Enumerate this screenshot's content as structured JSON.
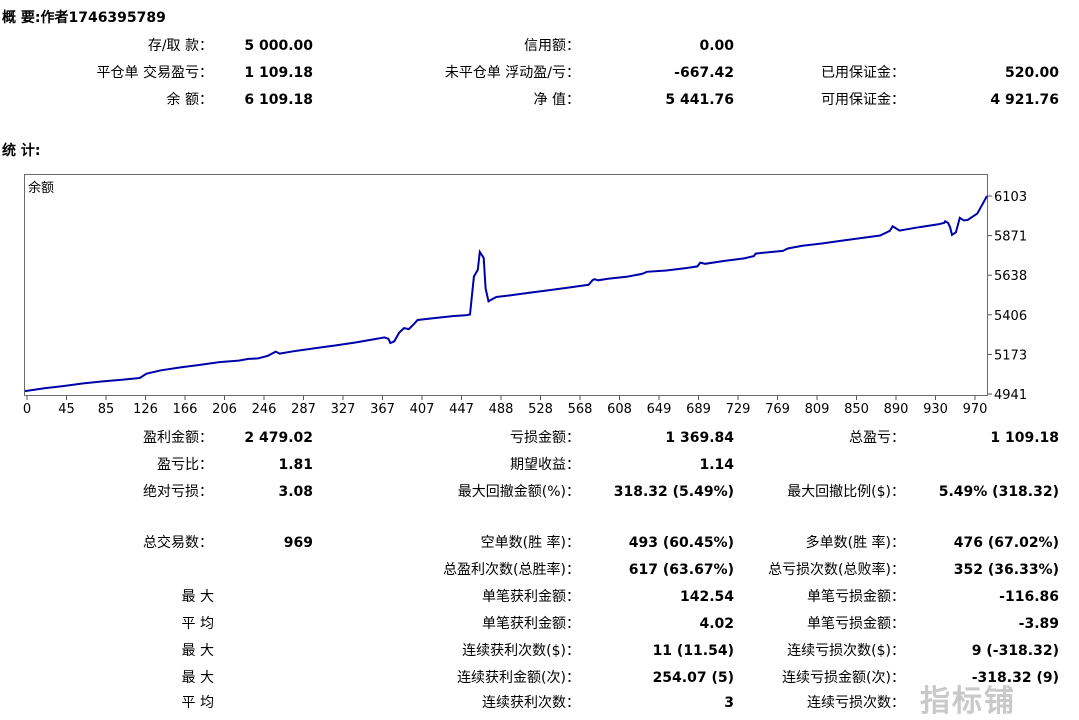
{
  "summary": {
    "title": "概 要:作者1746395789",
    "rows": [
      [
        {
          "label": "存/取 款：",
          "value": "5 000.00"
        },
        {
          "label": "信用额：",
          "value": "0.00"
        },
        {
          "label": "",
          "value": ""
        }
      ],
      [
        {
          "label": "平仓单 交易盈亏：",
          "value": "1 109.18"
        },
        {
          "label": "未平仓单 浮动盈/亏：",
          "value": "-667.42"
        },
        {
          "label": "已用保证金：",
          "value": "520.00"
        }
      ],
      [
        {
          "label": "余 额：",
          "value": "6 109.18"
        },
        {
          "label": "净 值：",
          "value": "5 441.76"
        },
        {
          "label": "可用保证金：",
          "value": "4 921.76"
        }
      ]
    ]
  },
  "stats": {
    "title": "统 计:",
    "rows": [
      {
        "c1": {
          "label": "盈利金额：",
          "value": "2 479.02"
        },
        "c2": {
          "label": "亏损金额：",
          "value": "1 369.84"
        },
        "c3": {
          "label": "总盈亏：",
          "value": "1 109.18"
        }
      },
      {
        "c1": {
          "label": "盈亏比：",
          "value": "1.81"
        },
        "c2": {
          "label": "期望收益：",
          "value": "1.14"
        },
        "c3": {
          "label": "",
          "value": ""
        }
      },
      {
        "c1": {
          "label": "绝对亏损：",
          "value": "3.08"
        },
        "c2": {
          "label": "最大回撤金额(%)：",
          "value": "318.32 (5.49%)"
        },
        "c3": {
          "label": "最大回撤比例($)：",
          "value": "5.49% (318.32)"
        }
      },
      {
        "c1": {
          "label": "总交易数：",
          "value": "969"
        },
        "c2": {
          "label": "空单数(胜 率)：",
          "value": "493 (60.45%)"
        },
        "c3": {
          "label": "多单数(胜 率)：",
          "value": "476 (67.02%)"
        }
      },
      {
        "c1": {
          "label": "",
          "value": ""
        },
        "c2": {
          "label": "总盈利次数(总胜率)：",
          "value": "617 (63.67%)"
        },
        "c3": {
          "label": "总亏损次数(总败率)：",
          "value": "352 (36.33%)"
        }
      },
      {
        "c1": {
          "label": "最 大",
          "value": ""
        },
        "c2": {
          "label": "单笔获利金额：",
          "value": "142.54"
        },
        "c3": {
          "label": "单笔亏损金额：",
          "value": "-116.86"
        }
      },
      {
        "c1": {
          "label": "平 均",
          "value": ""
        },
        "c2": {
          "label": "单笔获利金额：",
          "value": "4.02"
        },
        "c3": {
          "label": "单笔亏损金额：",
          "value": "-3.89"
        }
      },
      {
        "c1": {
          "label": "最 大",
          "value": ""
        },
        "c2": {
          "label": "连续获利次数($)：",
          "value": "11 (11.54)"
        },
        "c3": {
          "label": "连续亏损次数($)：",
          "value": "9 (-318.32)"
        }
      },
      {
        "c1": {
          "label": "最 大",
          "value": ""
        },
        "c2": {
          "label": "连续获利金额(次)：",
          "value": "254.07 (5)"
        },
        "c3": {
          "label": "连续亏损金额(次)：",
          "value": "-318.32 (9)"
        }
      },
      {
        "c1": {
          "label": "平 均",
          "value": ""
        },
        "c2": {
          "label": "连续获利次数：",
          "value": "3"
        },
        "c3": {
          "label": "连续亏损次数：",
          "value": ""
        }
      }
    ]
  },
  "chart_data": {
    "type": "line",
    "title": "余额",
    "x_ticks": [
      "0",
      "45",
      "85",
      "126",
      "166",
      "206",
      "246",
      "287",
      "327",
      "367",
      "407",
      "447",
      "488",
      "528",
      "568",
      "608",
      "649",
      "689",
      "729",
      "769",
      "809",
      "850",
      "890",
      "930",
      "970"
    ],
    "y_ticks": [
      "6103",
      "5871",
      "5638",
      "5406",
      "5173",
      "4941"
    ],
    "xlim": [
      0,
      990
    ],
    "ylim": [
      4941,
      6103
    ],
    "line_color": "#0000aa",
    "series": [
      {
        "x": [
          0,
          20,
          40,
          60,
          80,
          100,
          118,
          125,
          140,
          160,
          180,
          200,
          220,
          230,
          240,
          250,
          258,
          262,
          280,
          300,
          320,
          340,
          360,
          370,
          374,
          376,
          380,
          385,
          390,
          395,
          400,
          404,
          420,
          440,
          455,
          458,
          462,
          466,
          468,
          472,
          474,
          477,
          480,
          485,
          500,
          520,
          540,
          560,
          580,
          584,
          586,
          590,
          600,
          620,
          635,
          640,
          660,
          680,
          692,
          695,
          700,
          720,
          740,
          750,
          752,
          760,
          780,
          785,
          800,
          820,
          840,
          860,
          880,
          890,
          893,
          900,
          920,
          940,
          946,
          947,
          950,
          952,
          954,
          958,
          962,
          966,
          970,
          980,
          990
        ],
        "y": [
          4958,
          4975,
          4988,
          5003,
          5015,
          5025,
          5035,
          5060,
          5080,
          5097,
          5112,
          5128,
          5137,
          5147,
          5150,
          5165,
          5190,
          5178,
          5195,
          5211,
          5226,
          5243,
          5263,
          5273,
          5265,
          5240,
          5250,
          5300,
          5328,
          5322,
          5350,
          5375,
          5385,
          5398,
          5404,
          5408,
          5630,
          5670,
          5775,
          5740,
          5560,
          5485,
          5495,
          5510,
          5520,
          5536,
          5551,
          5566,
          5582,
          5609,
          5615,
          5608,
          5617,
          5630,
          5646,
          5658,
          5666,
          5680,
          5690,
          5712,
          5705,
          5722,
          5737,
          5750,
          5765,
          5770,
          5781,
          5795,
          5811,
          5824,
          5840,
          5856,
          5871,
          5898,
          5925,
          5900,
          5920,
          5937,
          5945,
          5955,
          5945,
          5920,
          5875,
          5890,
          5975,
          5960,
          5962,
          6000,
          6103
        ]
      }
    ]
  },
  "watermark": "指标铺"
}
